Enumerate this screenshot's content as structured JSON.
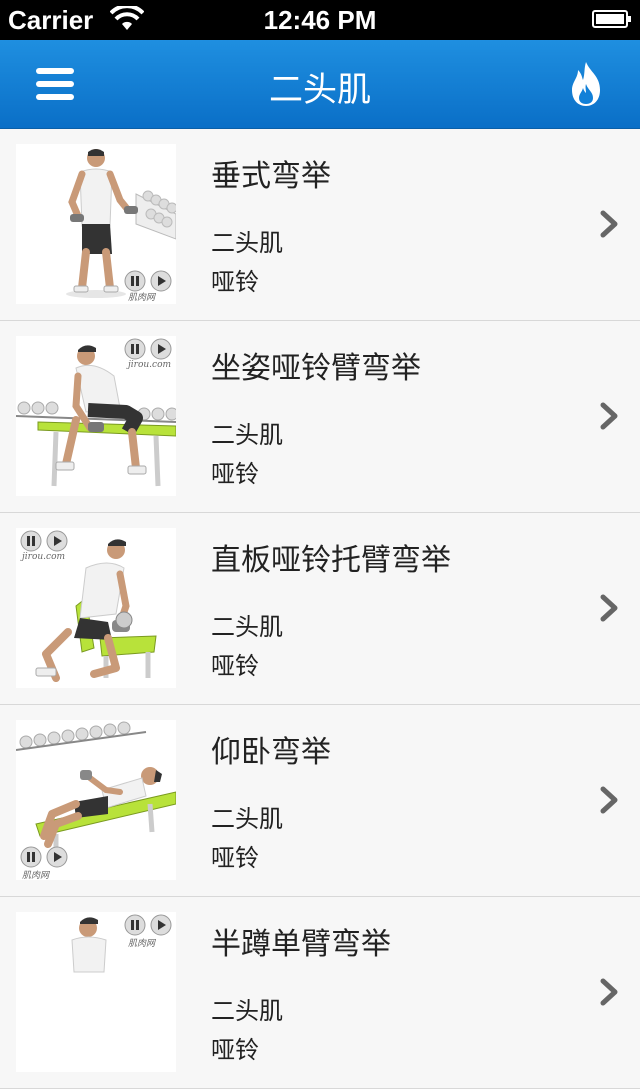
{
  "status_bar": {
    "carrier": "Carrier",
    "time": "12:46 PM"
  },
  "nav": {
    "title": "二头肌",
    "menu_icon": "hamburger-menu-icon",
    "right_icon": "fire-icon"
  },
  "colors": {
    "nav_bar": "#1180d8",
    "bench_accent": "#b8e23a"
  },
  "exercises": [
    {
      "name": "垂式弯举",
      "muscle": "二头肌",
      "equipment": "哑铃",
      "watermark": "肌肉网"
    },
    {
      "name": "坐姿哑铃臂弯举",
      "muscle": "二头肌",
      "equipment": "哑铃",
      "watermark": "jirou.com"
    },
    {
      "name": "直板哑铃托臂弯举",
      "muscle": "二头肌",
      "equipment": "哑铃",
      "watermark": "jirou.com"
    },
    {
      "name": "仰卧弯举",
      "muscle": "二头肌",
      "equipment": "哑铃",
      "watermark": "肌肉网"
    },
    {
      "name": "半蹲单臂弯举",
      "muscle": "二头肌",
      "equipment": "哑铃",
      "watermark": "肌肉网"
    }
  ]
}
